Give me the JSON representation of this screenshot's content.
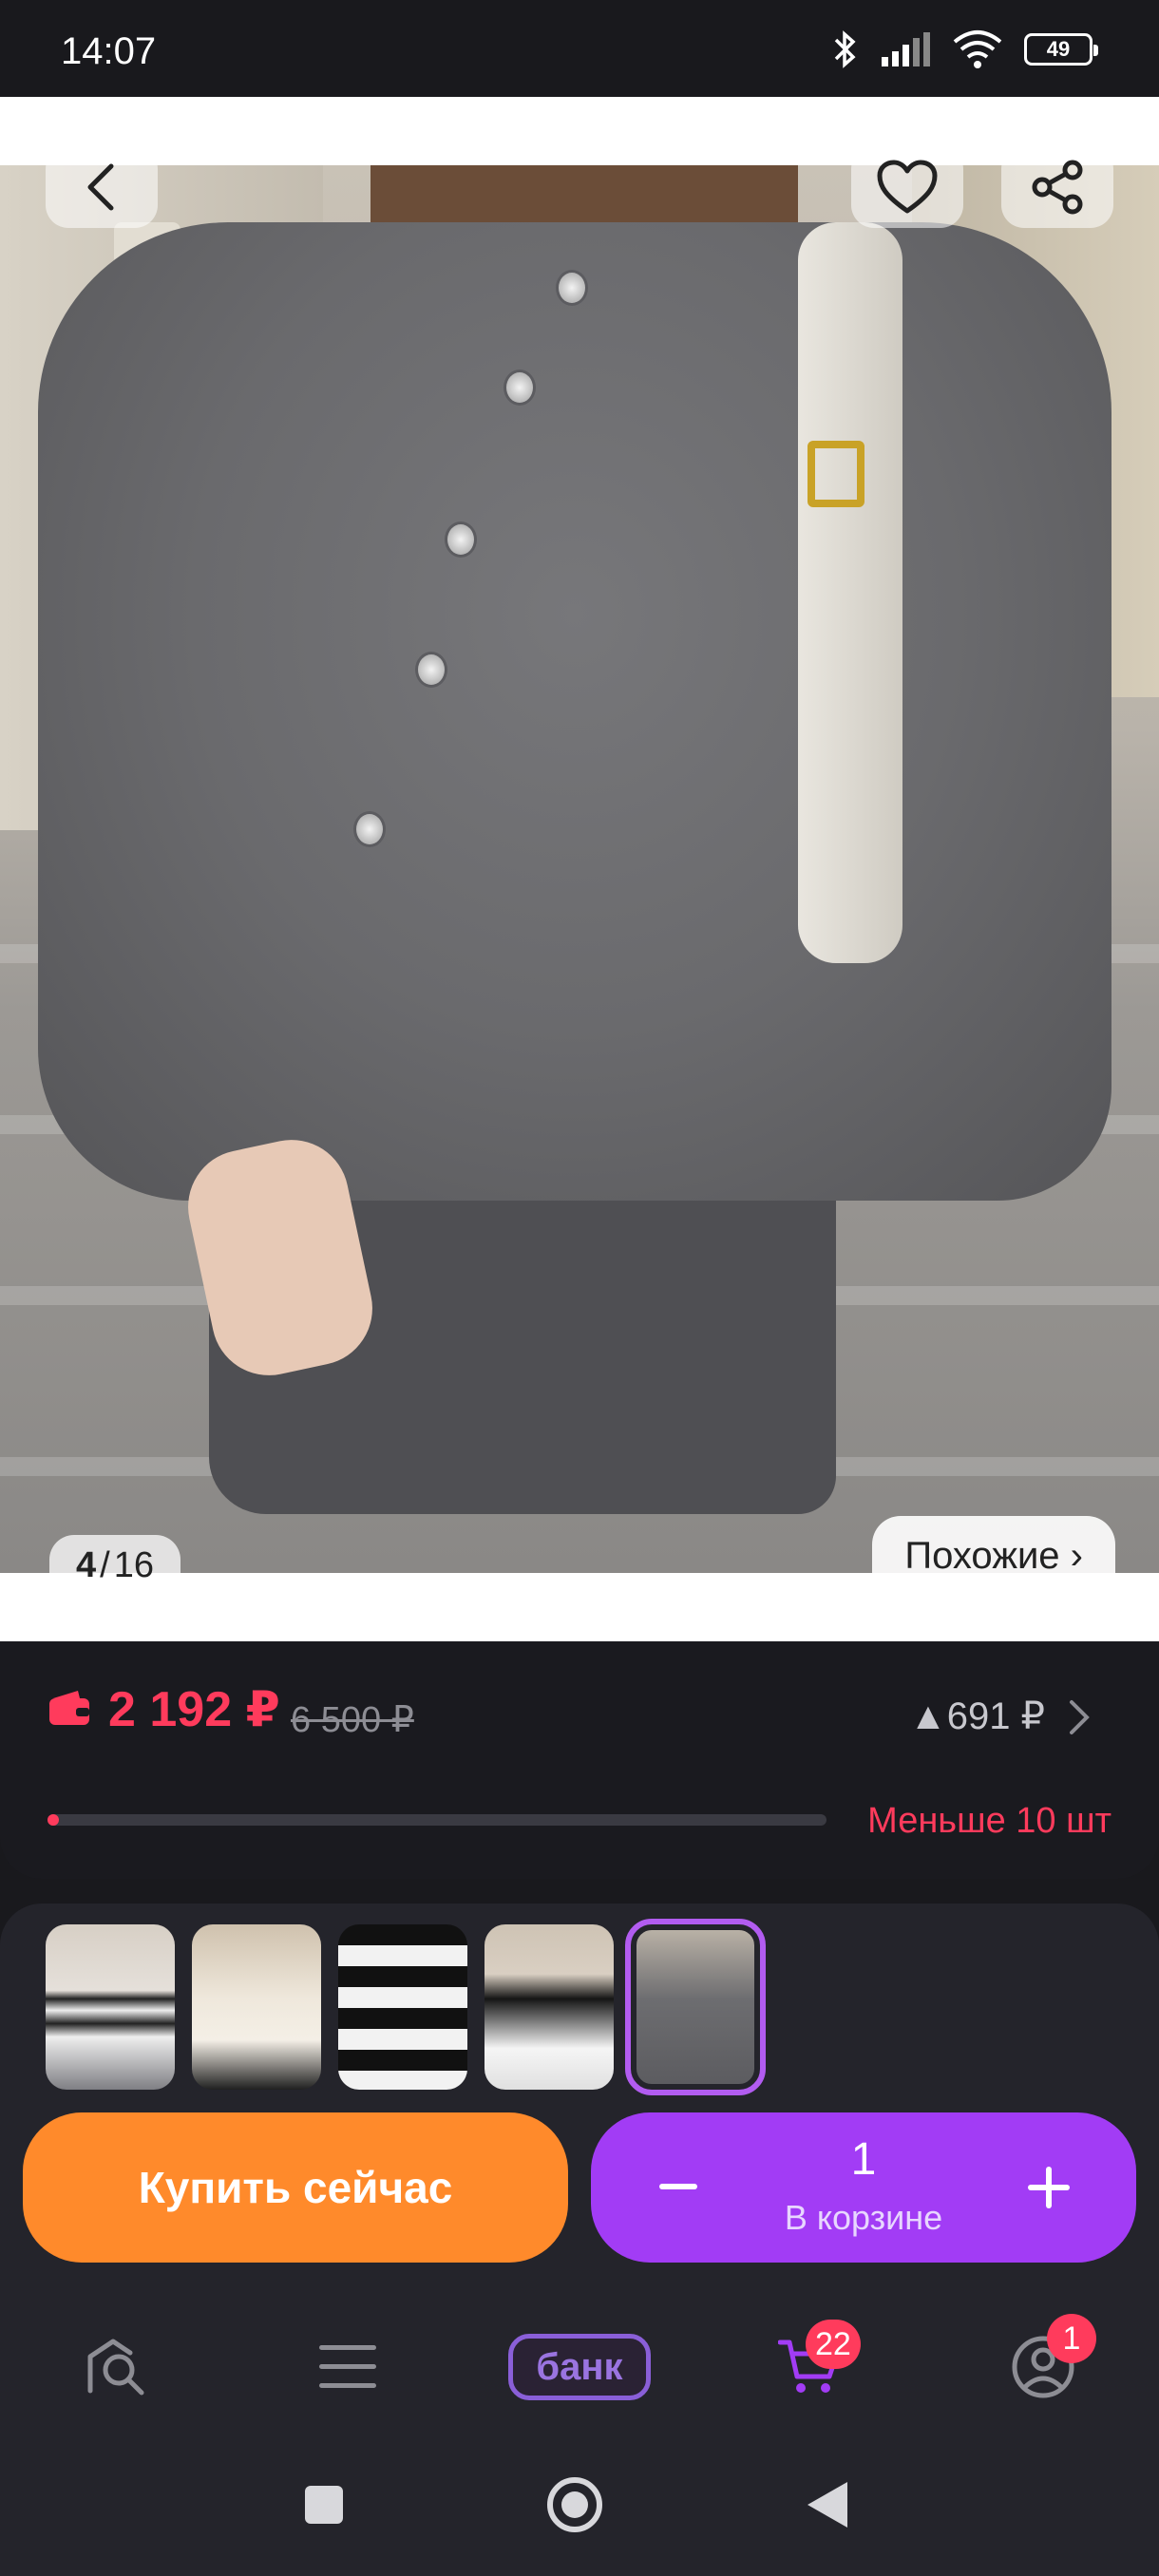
{
  "status_bar": {
    "time": "14:07",
    "battery": "49",
    "icons": [
      "bluetooth-icon",
      "signal-icon",
      "wifi-icon",
      "battery-icon"
    ]
  },
  "gallery": {
    "current": "4",
    "separator": "/",
    "total": "16",
    "similar_label": "Похожие ›",
    "icons": [
      "back-icon",
      "heart-icon",
      "share-icon"
    ]
  },
  "price": {
    "current": "2 192 ₽",
    "old": "6 500 ₽",
    "diff": "▲691 ₽",
    "stock_label": "Меньше 10 шт",
    "stock_fraction": 0.015,
    "accent_color": "#ff3b5c"
  },
  "variants": {
    "count": 5,
    "selected_index": 4
  },
  "actions": {
    "buy_label": "Купить сейчас",
    "cart_quantity": "1",
    "cart_label": "В корзине",
    "buy_color": "#ff8a2b",
    "cart_color": "#a23cf5"
  },
  "bottom_nav": {
    "items": [
      "home-icon",
      "catalog-icon",
      "bank",
      "cart-icon",
      "profile-icon"
    ],
    "bank_label": "банк",
    "cart_badge": "22",
    "profile_badge": "1"
  }
}
